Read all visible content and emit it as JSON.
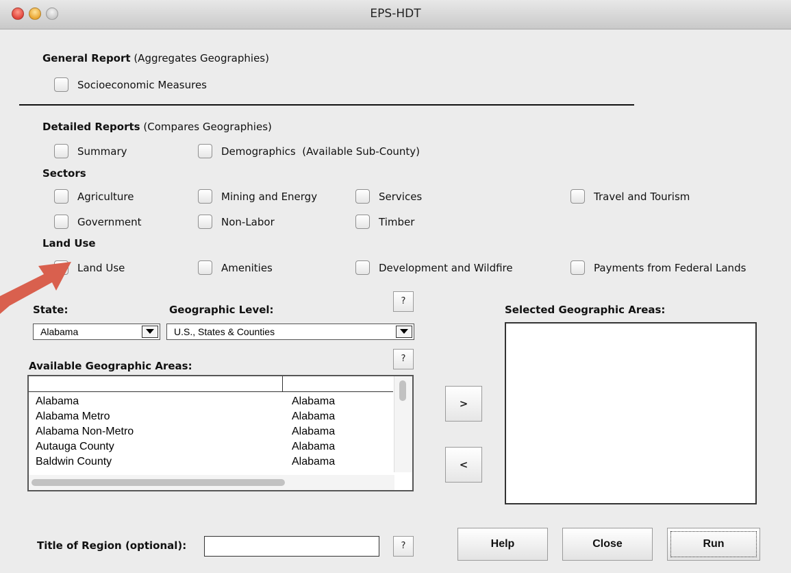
{
  "window": {
    "title": "EPS-HDT"
  },
  "general": {
    "header_bold": "General Report",
    "header_note": " (Aggregates Geographies)",
    "items": [
      "Socioeconomic Measures"
    ]
  },
  "detailed": {
    "header_bold": "Detailed Reports",
    "header_note": " (Compares Geographies)",
    "summary": "Summary",
    "demographics": "Demographics  (Available Sub-County)"
  },
  "sectors": {
    "header": "Sectors",
    "agriculture": "Agriculture",
    "mining": "Mining and Energy",
    "services": "Services",
    "travel": "Travel and Tourism",
    "government": "Government",
    "nonlabor": "Non-Labor",
    "timber": "Timber"
  },
  "landuse": {
    "header": "Land Use",
    "landuse": "Land Use",
    "amenities": "Amenities",
    "development": "Development and Wildfire",
    "payments": "Payments from Federal Lands"
  },
  "geo": {
    "state_label": "State:",
    "state_value": "Alabama",
    "level_label": "Geographic Level:",
    "level_value": "U.S., States & Counties",
    "help_glyph": "?",
    "available_label": "Available Geographic Areas:",
    "selected_label": "Selected Geographic Areas:",
    "rows": [
      {
        "name": "Alabama",
        "state": "Alabama"
      },
      {
        "name": "Alabama Metro",
        "state": "Alabama"
      },
      {
        "name": "Alabama Non-Metro",
        "state": "Alabama"
      },
      {
        "name": "Autauga County",
        "state": "Alabama"
      },
      {
        "name": "Baldwin County",
        "state": "Alabama"
      }
    ],
    "add_label": ">",
    "remove_label": "<"
  },
  "footer": {
    "title_label": "Title of Region (optional):",
    "title_value": "",
    "help_glyph": "?",
    "help_button": "Help",
    "close_button": "Close",
    "run_button": "Run"
  },
  "colors": {
    "annotation_arrow": "#d9604e",
    "window_bg": "#ececec"
  }
}
